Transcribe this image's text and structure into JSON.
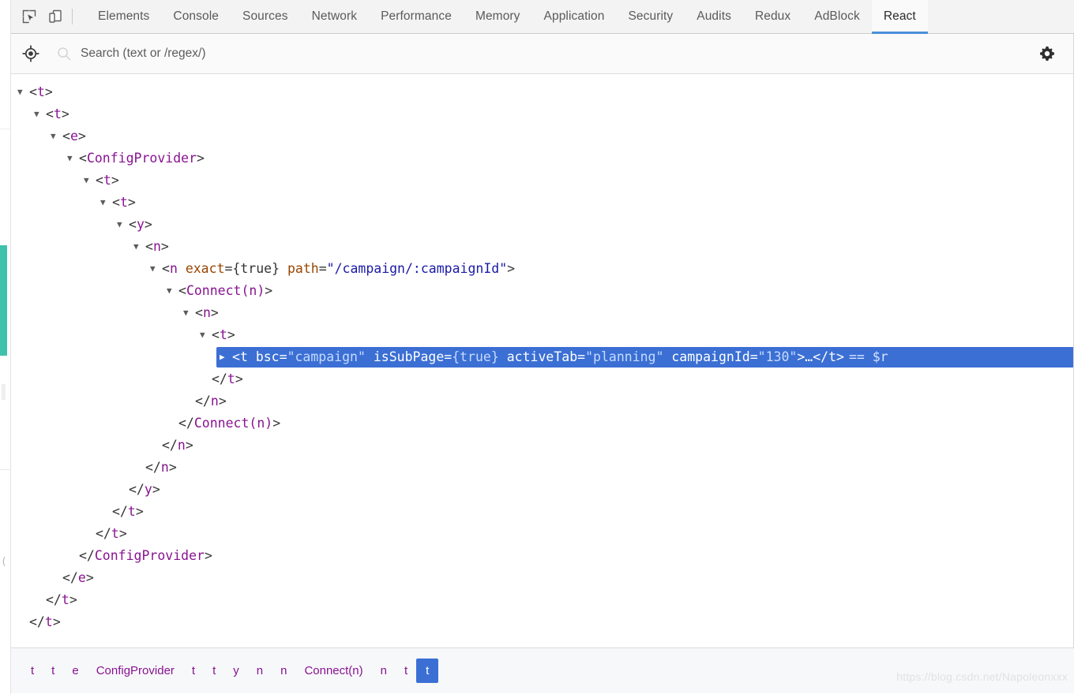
{
  "toolbar": {
    "inspect_icon": "inspect-cursor-icon",
    "device_icon": "device-toolbar-icon",
    "tabs": [
      {
        "label": "Elements",
        "active": false
      },
      {
        "label": "Console",
        "active": false
      },
      {
        "label": "Sources",
        "active": false
      },
      {
        "label": "Network",
        "active": false
      },
      {
        "label": "Performance",
        "active": false
      },
      {
        "label": "Memory",
        "active": false
      },
      {
        "label": "Application",
        "active": false
      },
      {
        "label": "Security",
        "active": false
      },
      {
        "label": "Audits",
        "active": false
      },
      {
        "label": "Redux",
        "active": false
      },
      {
        "label": "AdBlock",
        "active": false
      },
      {
        "label": "React",
        "active": true
      }
    ],
    "active_tab": "React",
    "accent_color": "#4a90d9"
  },
  "search": {
    "target_icon": "crosshair-target-icon",
    "magnifier_icon": "search-icon",
    "placeholder": "Search (text or /regex/)",
    "value": "",
    "settings_icon": "gear-icon"
  },
  "tree": {
    "selection_color": "#3b6fd4",
    "tag_color": "#881391",
    "attr_color": "#994500",
    "value_color": "#1a1aa6",
    "rows": [
      {
        "indent": 0,
        "arrow": "down",
        "text": "<t>"
      },
      {
        "indent": 1,
        "arrow": "down",
        "text": "<t>"
      },
      {
        "indent": 2,
        "arrow": "down",
        "text": "<e>"
      },
      {
        "indent": 3,
        "arrow": "down",
        "text": "<ConfigProvider>"
      },
      {
        "indent": 4,
        "arrow": "down",
        "text": "<t>"
      },
      {
        "indent": 5,
        "arrow": "down",
        "text": "<t>"
      },
      {
        "indent": 6,
        "arrow": "down",
        "text": "<y>"
      },
      {
        "indent": 7,
        "arrow": "down",
        "text": "<n>"
      },
      {
        "indent": 8,
        "arrow": "down",
        "text": "<n exact={true} path=\"/campaign/:campaignId\">"
      },
      {
        "indent": 9,
        "arrow": "down",
        "text": "<Connect(n)>"
      },
      {
        "indent": 10,
        "arrow": "down",
        "text": "<n>"
      },
      {
        "indent": 11,
        "arrow": "down",
        "text": "<t>"
      },
      {
        "indent": 12,
        "arrow": "right",
        "text": "<t bsc=\"campaign\" isSubPage={true} activeTab=\"planning\" campaignId=\"130\">…</t> == $r",
        "selected": true
      },
      {
        "indent": 11,
        "arrow": "blank",
        "text": "</t>"
      },
      {
        "indent": 10,
        "arrow": "blank",
        "text": "</n>"
      },
      {
        "indent": 9,
        "arrow": "blank",
        "text": "</Connect(n)>"
      },
      {
        "indent": 8,
        "arrow": "blank",
        "text": "</n>"
      },
      {
        "indent": 7,
        "arrow": "blank",
        "text": "</n>"
      },
      {
        "indent": 6,
        "arrow": "blank",
        "text": "</y>"
      },
      {
        "indent": 5,
        "arrow": "blank",
        "text": "</t>"
      },
      {
        "indent": 4,
        "arrow": "blank",
        "text": "</t>"
      },
      {
        "indent": 3,
        "arrow": "blank",
        "text": "</ConfigProvider>"
      },
      {
        "indent": 2,
        "arrow": "blank",
        "text": "</e>"
      },
      {
        "indent": 1,
        "arrow": "blank",
        "text": "</t>"
      },
      {
        "indent": 0,
        "arrow": "blank",
        "text": "</t>"
      }
    ],
    "selected_row": {
      "tag_open": "<t",
      "attrs": [
        {
          "name": "bsc",
          "value": "\"campaign\"",
          "braced": false
        },
        {
          "name": "isSubPage",
          "value": "{true}",
          "braced": true
        },
        {
          "name": "activeTab",
          "value": "\"planning\"",
          "braced": false
        },
        {
          "name": "campaignId",
          "value": "\"130\"",
          "braced": false
        }
      ],
      "tag_close": ">…</t>",
      "ref": "== $r"
    },
    "attr_row": {
      "tag_open": "<n",
      "attrs": [
        {
          "name": "exact",
          "value": "{true}"
        },
        {
          "name": "path",
          "value": "\"/campaign/:campaignId\""
        }
      ],
      "tag_close": ">"
    }
  },
  "breadcrumb": {
    "items": [
      {
        "label": "t",
        "selected": false
      },
      {
        "label": "t",
        "selected": false
      },
      {
        "label": "e",
        "selected": false
      },
      {
        "label": "ConfigProvider",
        "selected": false
      },
      {
        "label": "t",
        "selected": false
      },
      {
        "label": "t",
        "selected": false
      },
      {
        "label": "y",
        "selected": false
      },
      {
        "label": "n",
        "selected": false
      },
      {
        "label": "n",
        "selected": false
      },
      {
        "label": "Connect(n)",
        "selected": false
      },
      {
        "label": "n",
        "selected": false
      },
      {
        "label": "t",
        "selected": false
      },
      {
        "label": "t",
        "selected": true
      }
    ]
  },
  "watermark": {
    "text": "https://blog.csdn.net/Napoleonxxx"
  },
  "page_sliver": {
    "accent_color": "#3ec2ac",
    "glyph": "("
  }
}
